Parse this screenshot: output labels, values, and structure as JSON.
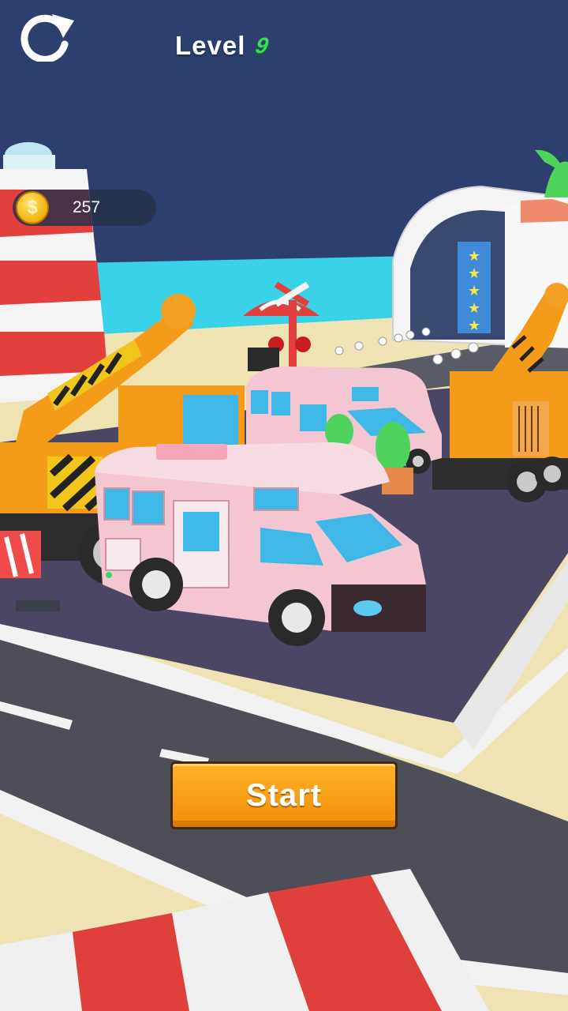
{
  "hud": {
    "level_label": "Level",
    "level_number": "9",
    "coin_count": "257",
    "coin_symbol": "$"
  },
  "start_button": {
    "label": "Start"
  },
  "icons": {
    "restart": "restart-arrow-icon",
    "coin": "coin-icon"
  },
  "colors": {
    "sky": "#2c3f6e",
    "sea": "#3ad2e8",
    "parking_lot": "#4a4663",
    "road": "#4e4e58",
    "rv_body": "#f3c6d1",
    "crane": "#f49b1a",
    "button": "#f4a118"
  }
}
